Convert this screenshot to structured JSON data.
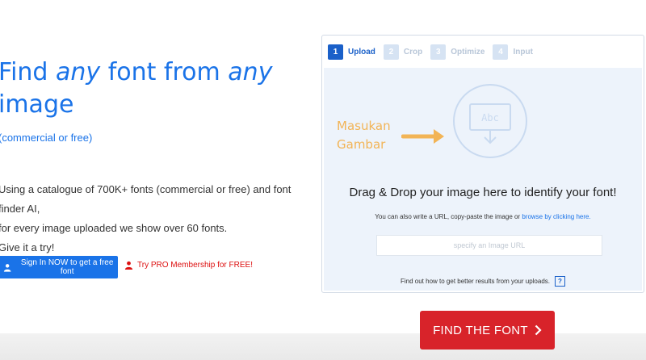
{
  "hero": {
    "title_part1": "Find ",
    "title_em1": "any",
    "title_part2": " font from ",
    "title_em2": "any",
    "title_part3": "image",
    "subtitle": "(commercial or free)",
    "desc_line1": "Using a catalogue of 700K+ fonts (commercial or free) and font finder AI,",
    "desc_line2": "for every image uploaded we show over 60 fonts.",
    "desc_line3": "Give it a try!"
  },
  "signin_label": "Sign In NOW to get a free font",
  "pro_label": "Try PRO Membership for FREE!",
  "steps": [
    {
      "num": "1",
      "label": "Upload",
      "active": true
    },
    {
      "num": "2",
      "label": "Crop",
      "active": false
    },
    {
      "num": "3",
      "label": "Optimize",
      "active": false
    },
    {
      "num": "4",
      "label": "Input",
      "active": false
    }
  ],
  "dropzone": {
    "icon_text": "Abc",
    "title": "Drag & Drop your image here to identify your font!",
    "hint_prefix": "You can also write a URL, copy-paste the image or ",
    "hint_link": "browse by clicking here.",
    "url_placeholder": "specify an Image URL",
    "help_text": "Find out how to get better results from your uploads.",
    "help_icon": "?"
  },
  "annotation": {
    "line1": "Masukan",
    "line2": "Gambar"
  },
  "cta_label": "FIND THE FONT",
  "colors": {
    "brand_blue": "#1a73e8",
    "cta_red": "#d8232a",
    "annotation_orange": "#f2b456",
    "dropzone_bg": "#edf3fb"
  },
  "icons": [
    "user-icon",
    "user-icon-red",
    "image-upload-icon",
    "help-icon",
    "chevron-right-icon",
    "arrow-right-icon"
  ]
}
